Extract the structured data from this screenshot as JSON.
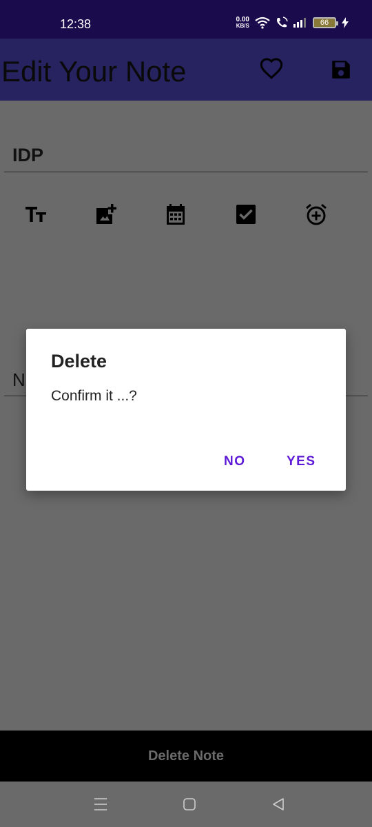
{
  "status_bar": {
    "time": "12:38",
    "net_speed_value": "0.00",
    "net_speed_unit": "KB/S",
    "battery_level": "66"
  },
  "app_bar": {
    "title": "Edit Your Note",
    "favorite_icon": "heart-outline-icon",
    "save_icon": "save-icon"
  },
  "editor": {
    "title_value": "IDP",
    "note_value": "N",
    "toolbar": [
      {
        "name": "text-size-icon"
      },
      {
        "name": "add-image-icon"
      },
      {
        "name": "calendar-icon"
      },
      {
        "name": "checkbox-icon"
      },
      {
        "name": "add-alarm-icon"
      }
    ]
  },
  "dialog": {
    "title": "Delete",
    "message": "Confirm it ...?",
    "no_label": "NO",
    "yes_label": "YES"
  },
  "bottom_bar": {
    "delete_label": "Delete Note"
  },
  "colors": {
    "status_bar": "#1a0b4d",
    "app_bar": "#272260",
    "scrim_background": "#6a6a6a",
    "dialog_accent": "#5c1ad6"
  }
}
